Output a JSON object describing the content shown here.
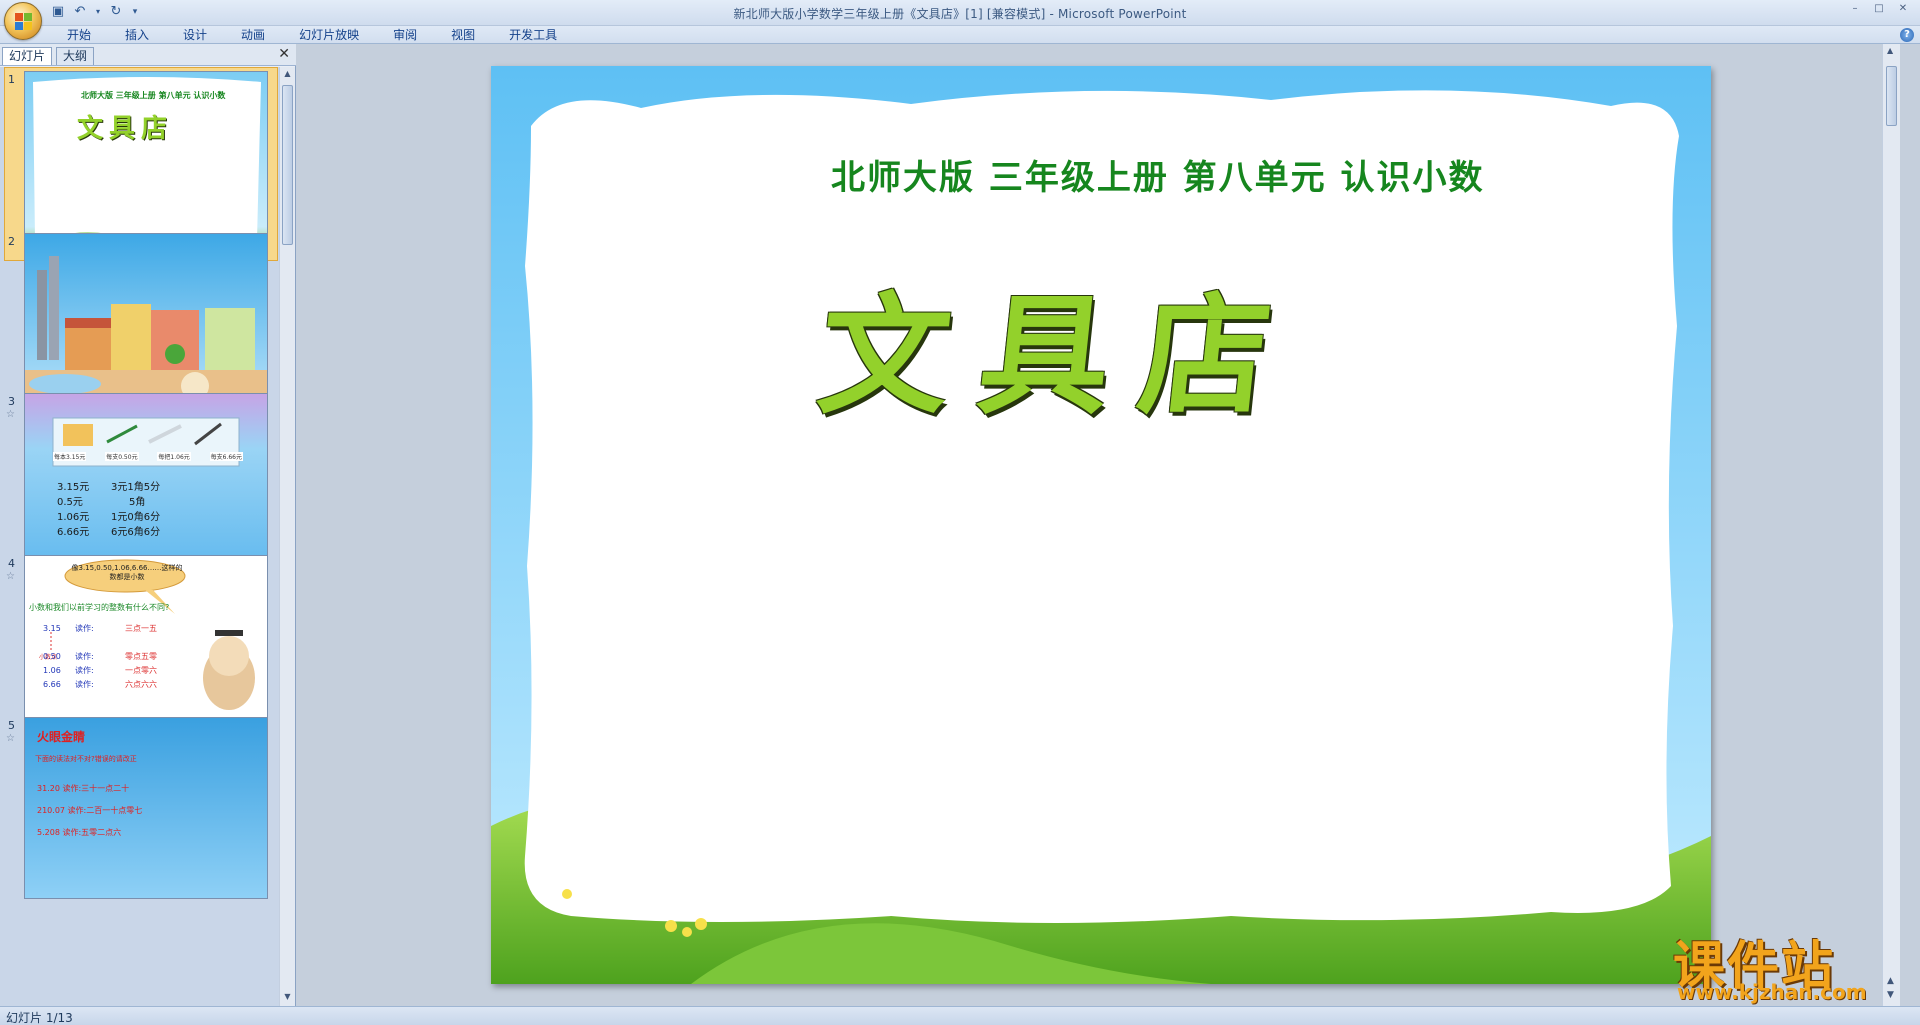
{
  "window": {
    "title": "新北师大版小学数学三年级上册《文具店》[1] [兼容模式] - Microsoft PowerPoint"
  },
  "ribbon": {
    "tabs": [
      "开始",
      "插入",
      "设计",
      "动画",
      "幻灯片放映",
      "审阅",
      "视图",
      "开发工具"
    ]
  },
  "left_pane": {
    "tabs": [
      "幻灯片",
      "大纲"
    ],
    "active_tab": "幻灯片",
    "slides": [
      {
        "num": "1",
        "selected": true,
        "subtitle": "北师大版  三年级上册  第八单元  认识小数",
        "title": "文具店"
      },
      {
        "num": "2",
        "selected": false
      },
      {
        "num": "3",
        "selected": false,
        "prices": [
          "每本3.15元",
          "每支0.50元",
          "每把1.06元",
          "每支6.66元"
        ],
        "rows": [
          [
            "3.15元",
            "3元1角5分"
          ],
          [
            "0.5元",
            "5角"
          ],
          [
            "1.06元",
            "1元0角6分"
          ],
          [
            "6.66元",
            "6元6角6分"
          ]
        ]
      },
      {
        "num": "4",
        "selected": false,
        "bubble": "像3.15,0.50,1.06,6.66……这样的数都是小数",
        "question": "小数和我们以前学习的整数有什么不同?",
        "point_label": "小数点",
        "rows": [
          [
            "3.15",
            "读作:",
            "三点一五"
          ],
          [
            "0.50",
            "读作:",
            "零点五零"
          ],
          [
            "1.06",
            "读作:",
            "一点零六"
          ],
          [
            "6.66",
            "读作:",
            "六点六六"
          ]
        ]
      },
      {
        "num": "5",
        "selected": false,
        "heading": "火眼金睛",
        "prompt": "下面的读法对不对?错误的请改正",
        "lines": [
          "31.20 读作:三十一点二十",
          "210.07 读作:二百一十点零七",
          "5.208 读作:五零二点六"
        ]
      }
    ]
  },
  "slide": {
    "subtitle": "北师大版  三年级上册  第八单元  认识小数",
    "title": "文具店"
  },
  "watermark": {
    "title": "课件站",
    "url": "www.kjzhan.com"
  },
  "status": {
    "text": "幻灯片 1/13"
  }
}
